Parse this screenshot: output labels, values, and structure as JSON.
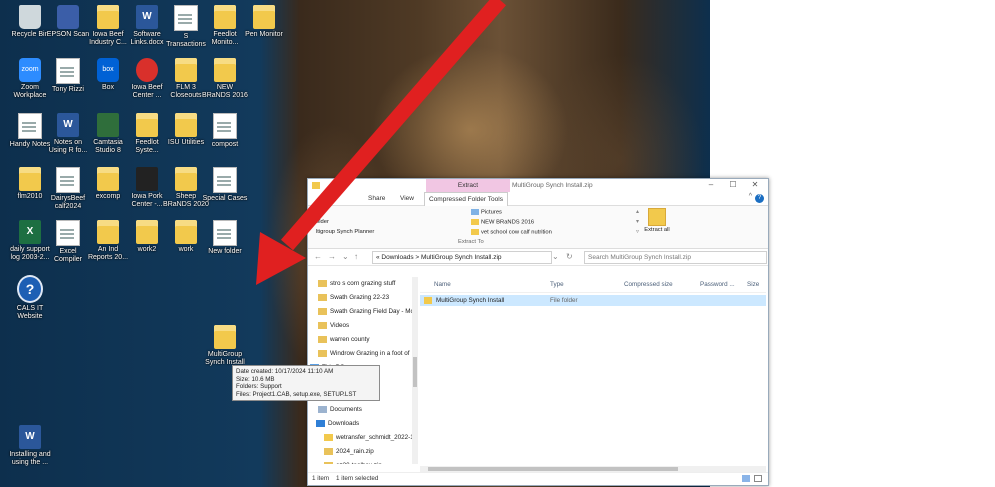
{
  "desktop": {
    "icons": [
      {
        "label": "Recycle Bin",
        "icon": "recycle-bin-icon"
      },
      {
        "label": "EPSON Scan",
        "icon": "epson-scan-icon"
      },
      {
        "label": "Iowa Beef Industry C...",
        "icon": "folder-icon"
      },
      {
        "label": "Software Links.docx",
        "icon": "word-doc-icon"
      },
      {
        "label": "S Transactions",
        "icon": "doc-icon"
      },
      {
        "label": "Feedlot Monito...",
        "icon": "folder-icon"
      },
      {
        "label": "Pen Monitor",
        "icon": "folder-icon"
      },
      {
        "label": "Zoom Workplace",
        "icon": "zoom-icon"
      },
      {
        "label": "Tony Rizzi",
        "icon": "doc-icon"
      },
      {
        "label": "Box",
        "icon": "box-icon"
      },
      {
        "label": "Iowa Beef Center ...",
        "icon": "iowa-beef-center-icon"
      },
      {
        "label": "FLM 3 Closeouts",
        "icon": "folder-icon"
      },
      {
        "label": "NEW BRaNDS 2016",
        "icon": "folder-icon"
      },
      {
        "label": "Handy Notes",
        "icon": "doc-icon"
      },
      {
        "label": "Notes on Using R fo...",
        "icon": "word-doc-icon"
      },
      {
        "label": "Camtasia Studio 8",
        "icon": "camtasia-icon"
      },
      {
        "label": "Feedlot Syste...",
        "icon": "folder-icon"
      },
      {
        "label": "ISU Utilities",
        "icon": "folder-icon"
      },
      {
        "label": "compost",
        "icon": "doc-icon"
      },
      {
        "label": "flm2010",
        "icon": "folder-icon"
      },
      {
        "label": "DairysBeef calf2024",
        "icon": "doc-icon"
      },
      {
        "label": "excomp",
        "icon": "folder-icon"
      },
      {
        "label": "Iowa Pork Center -...",
        "icon": "iowa-pork-center-icon"
      },
      {
        "label": "Sheep BRaNDS 2020",
        "icon": "folder-icon"
      },
      {
        "label": "Special Cases",
        "icon": "doc-icon"
      },
      {
        "label": "daily support log 2003-2...",
        "icon": "excel-icon"
      },
      {
        "label": "Excel Compiler",
        "icon": "doc-icon"
      },
      {
        "label": "An Ind Reports 20...",
        "icon": "folder-icon"
      },
      {
        "label": "work2",
        "icon": "folder-icon"
      },
      {
        "label": "work",
        "icon": "folder-icon"
      },
      {
        "label": "New folder",
        "icon": "doc-icon"
      },
      {
        "label": "CALS IT Website",
        "icon": "help-icon"
      },
      {
        "label": "MultiGroup Synch Install",
        "icon": "folder-icon"
      },
      {
        "label": "Installing and using the ...",
        "icon": "word-doc-icon"
      }
    ],
    "tooltip": {
      "line1": "Date created: 10/17/2024 11:10 AM",
      "line2": "Size: 10.6 MB",
      "line3": "Folders: Support",
      "line4": "Files: Project1.CAB, setup.exe, SETUP.LST"
    },
    "arrow_color": "#e02020"
  },
  "explorer": {
    "title": "MultiGroup Synch Install.zip",
    "context_tab": "Extract",
    "tabs": {
      "share": "Share",
      "view": "View",
      "compressed": "Compressed Folder Tools"
    },
    "ribbon": {
      "dest_left": [
        "s",
        "older",
        "ltigroup Synch Planner"
      ],
      "dest_right": [
        "Pictures",
        "NEW BRaNDS 2016",
        "vet school cow calf nutrition"
      ],
      "extract_to": "Extract To",
      "extract_all": "Extract all"
    },
    "address": "« Downloads  >  MultiGroup Synch Install.zip",
    "search_placeholder": "Search MultiGroup Synch Install.zip",
    "nav_items": [
      {
        "label": "stro s corn grazing stuff",
        "icon": "zip-folder-icon",
        "selected": false
      },
      {
        "label": "Swath Grazing 22-23",
        "icon": "zip-folder-icon",
        "selected": false
      },
      {
        "label": "Swath Grazing Field Day - Mc",
        "icon": "zip-folder-icon",
        "selected": false
      },
      {
        "label": "Videos",
        "icon": "zip-folder-icon",
        "selected": false
      },
      {
        "label": "warren county",
        "icon": "zip-folder-icon",
        "selected": false
      },
      {
        "label": "Windrow Grazing in a foot of",
        "icon": "zip-folder-icon",
        "selected": false
      },
      {
        "label": "This PC",
        "icon": "this-pc-icon",
        "selected": false
      },
      {
        "label": "jects",
        "icon": "folder-icon",
        "selected": false
      },
      {
        "label": "p",
        "icon": "folder-icon",
        "selected": false
      },
      {
        "label": "Documents",
        "icon": "documents-icon",
        "selected": false
      },
      {
        "label": "Downloads",
        "icon": "downloads-icon",
        "selected": false
      },
      {
        "label": "wetransfer_schmidt_2022-1",
        "icon": "folder-icon",
        "selected": false
      },
      {
        "label": "2024_rain.zip",
        "icon": "zip-folder-icon",
        "selected": false
      },
      {
        "label": "ez30-toolbox.zip",
        "icon": "zip-folder-icon",
        "selected": false
      },
      {
        "label": "MultiGroup Synch Install.zi",
        "icon": "zip-folder-icon",
        "selected": true
      }
    ],
    "columns": {
      "name": "Name",
      "type": "Type",
      "compressed": "Compressed size",
      "password": "Password ...",
      "size": "Size"
    },
    "rows": [
      {
        "name": "MultiGroup Synch Install",
        "type": "File folder",
        "compressed": "",
        "password": "",
        "size": ""
      }
    ],
    "status": {
      "count": "1 item",
      "selected": "1 item selected"
    }
  }
}
